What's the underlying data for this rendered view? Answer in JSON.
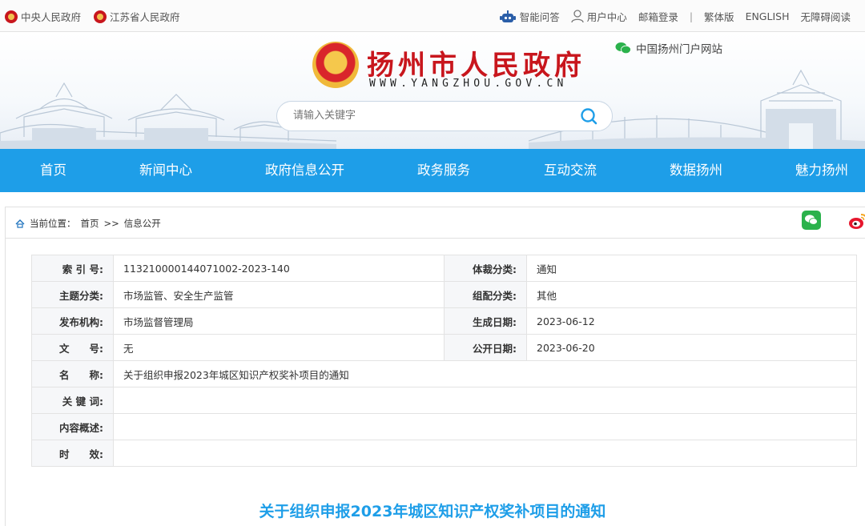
{
  "topbar": {
    "left": [
      {
        "label": "中央人民政府",
        "icon": "national-emblem-icon"
      },
      {
        "label": "江苏省人民政府",
        "icon": "national-emblem-icon"
      }
    ],
    "right": {
      "smart_qa": "智能问答",
      "user_center": "用户中心",
      "mail_login": "邮箱登录",
      "separator": "|",
      "traditional": "繁体版",
      "english": "ENGLISH",
      "accessible": "无障碍阅读"
    }
  },
  "header": {
    "title": "扬州市人民政府",
    "url": "WWW.YANGZHOU.GOV.CN",
    "portal_label": "中国扬州门户网站",
    "search_placeholder": "请输入关键字"
  },
  "nav": {
    "items": [
      "首页",
      "新闻中心",
      "政府信息公开",
      "政务服务",
      "互动交流",
      "数据扬州",
      "魅力扬州"
    ]
  },
  "breadcrumb": {
    "prefix": "当前位置：",
    "home": "首页",
    "separator": ">>",
    "current": "信息公开"
  },
  "meta": {
    "index_label": "索 引 号:",
    "index_value": "113210000144071002-2023-140",
    "genre_label": "体裁分类:",
    "genre_value": "通知",
    "topic_label": "主题分类:",
    "topic_value": "市场监管、安全生产监管",
    "config_label": "组配分类:",
    "config_value": "其他",
    "org_label": "发布机构:",
    "org_value": "市场监督管理局",
    "created_label": "生成日期:",
    "created_value": "2023-06-12",
    "docno_label": "文　　号:",
    "docno_value": "无",
    "public_label": "公开日期:",
    "public_value": "2023-06-20",
    "name_label": "名　　称:",
    "name_value": "关于组织申报2023年城区知识产权奖补项目的通知",
    "keyword_label": "关 键 词:",
    "keyword_value": "",
    "summary_label": "内容概述:",
    "summary_value": "",
    "validity_label": "时　　效:",
    "validity_value": ""
  },
  "article": {
    "title": "关于组织申报2023年城区知识产权奖补项目的通知"
  },
  "colors": {
    "nav_blue": "#1e9ee8",
    "title_red": "#c8161d",
    "wechat_green": "#2bb24c"
  }
}
